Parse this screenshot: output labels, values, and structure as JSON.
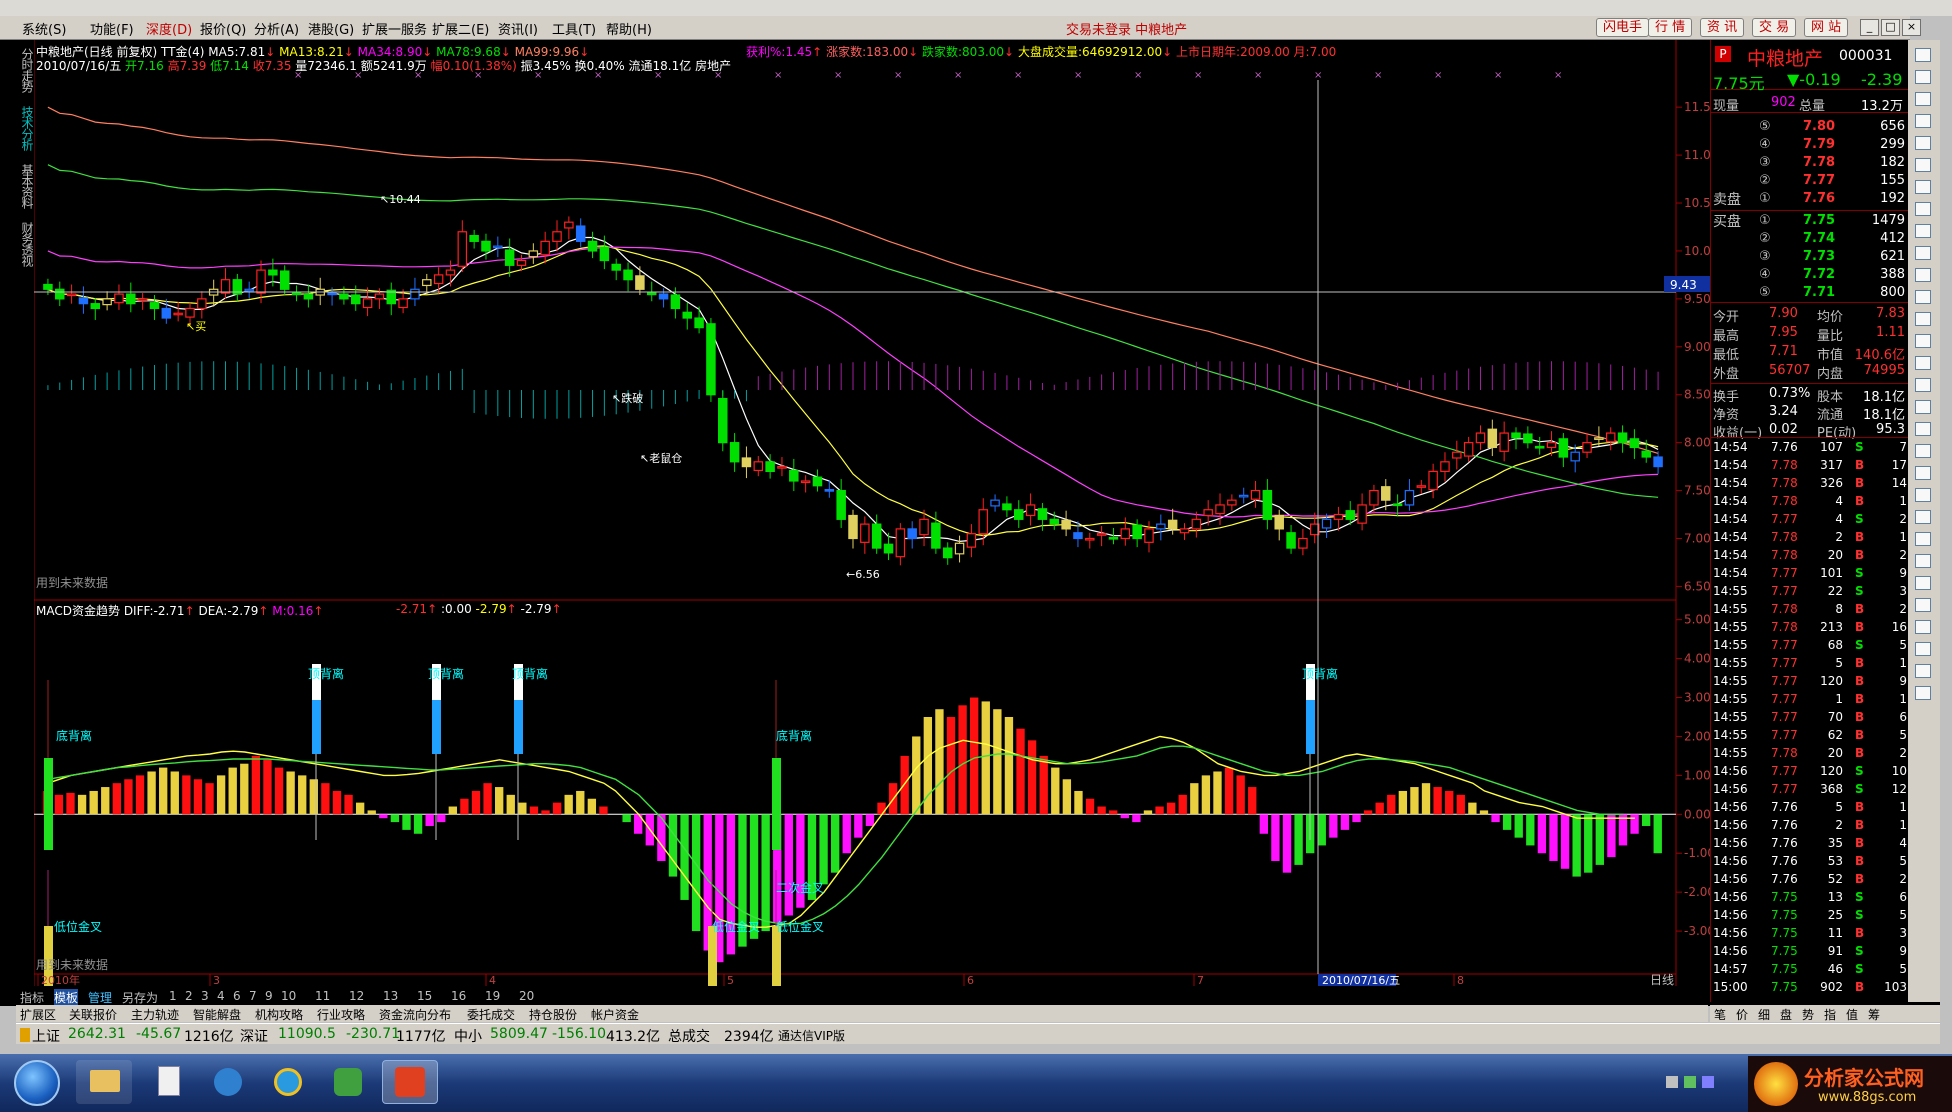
{
  "menu": {
    "items": [
      "系统(S)",
      "功能(F)",
      "深度(D)",
      "报价(Q)",
      "分析(A)",
      "港股(G)",
      "扩展一服务",
      "扩展二(E)",
      "资讯(I)",
      "工具(T)",
      "帮助(H)"
    ],
    "center_msg": "交易未登录  中粮地产",
    "right_buttons": [
      "闪电手",
      "行  情",
      "资  讯",
      "交  易",
      "网  站"
    ]
  },
  "left_tabs": [
    "分时走势",
    "技术分析",
    "基本资料",
    "财务透视"
  ],
  "header": {
    "line1_title": "中粮地产(日线 前复权) TT金(4)",
    "ma5": "MA5:7.81",
    "ma13": "MA13:8.21",
    "ma34": "MA34:8.90",
    "ma78": "MA78:9.68",
    "ma99": "MA99:9.96",
    "win_rate": "获利%:1.45",
    "up_count": "涨家数:183.00",
    "down_count": "跌家数:803.00",
    "market_vol": "大盘成交量:64692912.00",
    "listing": "上市日期年:2009.00 月:7.00",
    "line2_date": "2010/07/16/五",
    "open": "开7.16",
    "high": "高7.39",
    "low": "低7.14",
    "close": "收7.35",
    "vol": "量72346.1",
    "amount": "额5241.9万",
    "change": "幅0.10(1.38%)",
    "amp": "振3.45%",
    "turnover": "换0.40%",
    "float": "流通18.1亿",
    "sector": "房地产"
  },
  "chart_annotations": {
    "buy": "买",
    "peak": "10.44",
    "break": "跌破",
    "trap": "老鼠仓",
    "low": "6.56",
    "future_note": "用到未来数据"
  },
  "macd": {
    "title": "MACD资金趋势",
    "diff": "DIFF:-2.71",
    "dea": "DEA:-2.79",
    "m": "M:0.16",
    "v1": "-2.71",
    "v2": ":0.00",
    "v3": "-2.79",
    "v4": "-2.79",
    "top_div": "顶背离",
    "bottom_div": "底背离",
    "low_cross": "低位金叉",
    "second_cross": "二次金叉",
    "future_note": "用到未来数据"
  },
  "price_axis": [
    "11.50",
    "11.00",
    "10.50",
    "10.00",
    "9.50",
    "9.00",
    "8.50",
    "8.00",
    "7.50",
    "7.00",
    "6.50"
  ],
  "price_cursor": "9.43",
  "macd_axis": [
    "5.00",
    "4.00",
    "3.00",
    "2.00",
    "1.00",
    "0.00",
    "-1.00",
    "-2.00",
    "-3.00"
  ],
  "time_axis": {
    "labels": [
      "2010年",
      "3",
      "4",
      "5",
      "6",
      "7",
      "8"
    ],
    "cursor_date": "2010/07/16/五",
    "period": "日线"
  },
  "bottom_tabs": [
    "指标",
    "模板",
    "管理",
    "另存为",
    "1",
    "2",
    "3",
    "4",
    "6",
    "7",
    "9",
    "10",
    "11",
    "12",
    "13",
    "15",
    "16",
    "19",
    "20"
  ],
  "bottom_tabs2": [
    "扩展区",
    "关联报价",
    "主力轨迹",
    "智能解盘",
    "机构攻略",
    "行业攻略",
    "资金流向分布",
    "委托成交",
    "持仓股份",
    "帐户资金"
  ],
  "status": {
    "sh_label": "上证",
    "sh_value": "2642.31",
    "sh_change": "-45.67",
    "sh_amount": "1216亿",
    "sz_label": "深证",
    "sz_value": "11090.5",
    "sz_change": "-230.71",
    "sz_amount": "1177亿",
    "zx_label": "中小",
    "zx_value": "5809.47",
    "zx_change": "-156.10",
    "zx_amount": "413.2亿",
    "total_label": "总成交",
    "total_value": "2394亿",
    "vendor": "通达信VIP版"
  },
  "quote": {
    "badge": "P",
    "name": "中粮地产",
    "code": "000031",
    "price": "7.75元",
    "change": "▼-0.19",
    "change_pct": "-2.39",
    "cur_vol_label": "现量",
    "cur_vol": "902",
    "total_vol_label": "总量",
    "total_vol": "13.2万",
    "sells": [
      {
        "lvl": "⑤",
        "price": "7.80",
        "vol": "656"
      },
      {
        "lvl": "④",
        "price": "7.79",
        "vol": "299"
      },
      {
        "lvl": "③",
        "price": "7.78",
        "vol": "182"
      },
      {
        "lvl": "②",
        "price": "7.77",
        "vol": "155"
      },
      {
        "lvl": "①",
        "price": "7.76",
        "vol": "192"
      }
    ],
    "sell_label": "卖盘",
    "buy_label": "买盘",
    "buys": [
      {
        "lvl": "①",
        "price": "7.75",
        "vol": "1479"
      },
      {
        "lvl": "②",
        "price": "7.74",
        "vol": "412"
      },
      {
        "lvl": "③",
        "price": "7.73",
        "vol": "621"
      },
      {
        "lvl": "④",
        "price": "7.72",
        "vol": "388"
      },
      {
        "lvl": "⑤",
        "price": "7.71",
        "vol": "800"
      }
    ],
    "stats": [
      {
        "l1": "今开",
        "v1": "7.90",
        "l2": "均价",
        "v2": "7.83"
      },
      {
        "l1": "最高",
        "v1": "7.95",
        "l2": "量比",
        "v2": "1.11"
      },
      {
        "l1": "最低",
        "v1": "7.71",
        "l2": "市值",
        "v2": "140.6亿"
      },
      {
        "l1": "外盘",
        "v1": "56707",
        "l2": "内盘",
        "v2": "74995"
      }
    ],
    "stats2": [
      {
        "l1": "换手",
        "v1": "0.73%",
        "l2": "股本",
        "v2": "18.1亿"
      },
      {
        "l1": "净资",
        "v1": "3.24",
        "l2": "流通",
        "v2": "18.1亿"
      },
      {
        "l1": "收益(一)",
        "v1": "0.02",
        "l2": "PE(动)",
        "v2": "95.3"
      }
    ],
    "ticks": [
      {
        "t": "14:54",
        "p": "7.76",
        "v": "107",
        "s": "S",
        "n": "7"
      },
      {
        "t": "14:54",
        "p": "7.78",
        "v": "317",
        "s": "B",
        "n": "17"
      },
      {
        "t": "14:54",
        "p": "7.78",
        "v": "326",
        "s": "B",
        "n": "14"
      },
      {
        "t": "14:54",
        "p": "7.78",
        "v": "4",
        "s": "B",
        "n": "1"
      },
      {
        "t": "14:54",
        "p": "7.77",
        "v": "4",
        "s": "S",
        "n": "2"
      },
      {
        "t": "14:54",
        "p": "7.78",
        "v": "2",
        "s": "B",
        "n": "1"
      },
      {
        "t": "14:54",
        "p": "7.78",
        "v": "20",
        "s": "B",
        "n": "2"
      },
      {
        "t": "14:54",
        "p": "7.77",
        "v": "101",
        "s": "S",
        "n": "9"
      },
      {
        "t": "14:55",
        "p": "7.77",
        "v": "22",
        "s": "S",
        "n": "3"
      },
      {
        "t": "14:55",
        "p": "7.78",
        "v": "8",
        "s": "B",
        "n": "2"
      },
      {
        "t": "14:55",
        "p": "7.78",
        "v": "213",
        "s": "B",
        "n": "16"
      },
      {
        "t": "14:55",
        "p": "7.77",
        "v": "68",
        "s": "S",
        "n": "5"
      },
      {
        "t": "14:55",
        "p": "7.77",
        "v": "5",
        "s": "B",
        "n": "1"
      },
      {
        "t": "14:55",
        "p": "7.77",
        "v": "120",
        "s": "B",
        "n": "9"
      },
      {
        "t": "14:55",
        "p": "7.77",
        "v": "1",
        "s": "B",
        "n": "1"
      },
      {
        "t": "14:55",
        "p": "7.77",
        "v": "70",
        "s": "B",
        "n": "6"
      },
      {
        "t": "14:55",
        "p": "7.77",
        "v": "62",
        "s": "B",
        "n": "5"
      },
      {
        "t": "14:55",
        "p": "7.78",
        "v": "20",
        "s": "B",
        "n": "2"
      },
      {
        "t": "14:56",
        "p": "7.77",
        "v": "120",
        "s": "S",
        "n": "10"
      },
      {
        "t": "14:56",
        "p": "7.77",
        "v": "368",
        "s": "S",
        "n": "12"
      },
      {
        "t": "14:56",
        "p": "7.76",
        "v": "5",
        "s": "B",
        "n": "1"
      },
      {
        "t": "14:56",
        "p": "7.76",
        "v": "2",
        "s": "B",
        "n": "1"
      },
      {
        "t": "14:56",
        "p": "7.76",
        "v": "35",
        "s": "B",
        "n": "4"
      },
      {
        "t": "14:56",
        "p": "7.76",
        "v": "53",
        "s": "B",
        "n": "5"
      },
      {
        "t": "14:56",
        "p": "7.76",
        "v": "52",
        "s": "B",
        "n": "2"
      },
      {
        "t": "14:56",
        "p": "7.75",
        "v": "13",
        "s": "S",
        "n": "6"
      },
      {
        "t": "14:56",
        "p": "7.75",
        "v": "25",
        "s": "S",
        "n": "5"
      },
      {
        "t": "14:56",
        "p": "7.75",
        "v": "11",
        "s": "B",
        "n": "3"
      },
      {
        "t": "14:56",
        "p": "7.75",
        "v": "91",
        "s": "S",
        "n": "9"
      },
      {
        "t": "14:57",
        "p": "7.75",
        "v": "46",
        "s": "S",
        "n": "5"
      },
      {
        "t": "15:00",
        "p": "7.75",
        "v": "902",
        "s": "B",
        "n": "103"
      }
    ]
  },
  "qp_tabs": [
    "笔",
    "价",
    "细",
    "盘",
    "势",
    "指",
    "值",
    "筹"
  ],
  "logo": {
    "name": "分析家公式网",
    "url": "www.88gs.com"
  },
  "chart_data": [
    {
      "type": "candlestick",
      "title": "中粮地产(日线 前复权) TT金(4)",
      "ylim": [
        6.4,
        11.7
      ],
      "x_labels": [
        "2010年",
        "3",
        "4",
        "5",
        "6",
        "7",
        "8"
      ],
      "annotations": {
        "peak": 10.44,
        "low": 6.56
      },
      "series": [
        {
          "name": "MA5",
          "value": 7.81
        },
        {
          "name": "MA13",
          "value": 8.21
        },
        {
          "name": "MA34",
          "value": 8.9
        },
        {
          "name": "MA78",
          "value": 9.68
        },
        {
          "name": "MA99",
          "value": 9.96
        }
      ],
      "closes": [
        9.6,
        9.5,
        9.55,
        9.45,
        9.4,
        9.5,
        9.55,
        9.45,
        9.5,
        9.4,
        9.3,
        9.35,
        9.4,
        9.5,
        9.6,
        9.7,
        9.55,
        9.6,
        9.8,
        9.75,
        9.6,
        9.55,
        9.5,
        9.6,
        9.55,
        9.5,
        9.45,
        9.5,
        9.55,
        9.45,
        9.5,
        9.6,
        9.7,
        9.75,
        9.8,
        10.2,
        10.1,
        10.0,
        10.05,
        9.85,
        9.9,
        10.0,
        10.1,
        10.2,
        10.3,
        10.1,
        10.0,
        9.9,
        9.8,
        9.7,
        9.6,
        9.55,
        9.5,
        9.4,
        9.3,
        9.2,
        8.5,
        8.0,
        7.8,
        7.75,
        7.8,
        7.7,
        7.75,
        7.6,
        7.6,
        7.55,
        7.5,
        7.2,
        7.0,
        7.15,
        6.9,
        6.85,
        7.1,
        7.0,
        7.2,
        6.9,
        6.8,
        6.95,
        7.05,
        7.3,
        7.4,
        7.3,
        7.2,
        7.35,
        7.2,
        7.15,
        7.1,
        7.0,
        7.0,
        7.05,
        7.0,
        7.1,
        7.0,
        7.1,
        7.15,
        7.1,
        7.1,
        7.2,
        7.3,
        7.35,
        7.4,
        7.45,
        7.5,
        7.2,
        7.1,
        6.9,
        7.0,
        7.15,
        7.2,
        7.25,
        7.2,
        7.35,
        7.5,
        7.4,
        7.35,
        7.5,
        7.55,
        7.7,
        7.8,
        7.9,
        8.0,
        8.1,
        7.95,
        8.1,
        8.05,
        8.0,
        7.95,
        8.0,
        7.85,
        7.9,
        8.0,
        8.05,
        8.1,
        8.0,
        7.95,
        7.85,
        7.75
      ]
    },
    {
      "type": "bar",
      "title": "MACD资金趋势",
      "ylim": [
        -4.0,
        5.3
      ],
      "series": [
        {
          "name": "DIFF",
          "value": -2.71
        },
        {
          "name": "DEA",
          "value": -2.79
        },
        {
          "name": "M",
          "value": 0.16
        }
      ],
      "hist": [
        0.6,
        0.5,
        0.55,
        0.5,
        0.6,
        0.7,
        0.8,
        0.9,
        1.0,
        1.1,
        1.2,
        1.1,
        1.0,
        0.9,
        0.8,
        1.0,
        1.2,
        1.3,
        1.5,
        1.4,
        1.2,
        1.1,
        1.0,
        0.9,
        0.8,
        0.6,
        0.5,
        0.3,
        0.1,
        -0.1,
        -0.2,
        -0.4,
        -0.5,
        -0.3,
        -0.2,
        0.2,
        0.4,
        0.6,
        0.8,
        0.7,
        0.5,
        0.3,
        0.2,
        0.1,
        0.3,
        0.5,
        0.6,
        0.4,
        0.2,
        0.0,
        -0.2,
        -0.5,
        -0.8,
        -1.2,
        -1.6,
        -2.2,
        -3.0,
        -3.5,
        -3.8,
        -3.6,
        -3.4,
        -3.2,
        -3.0,
        -2.8,
        -2.6,
        -2.4,
        -2.2,
        -1.8,
        -1.5,
        -1.0,
        -0.6,
        -0.3,
        0.3,
        0.8,
        1.5,
        2.0,
        2.5,
        2.7,
        2.5,
        2.8,
        3.0,
        2.9,
        2.7,
        2.5,
        2.2,
        1.9,
        1.5,
        1.2,
        0.9,
        0.6,
        0.4,
        0.2,
        0.1,
        -0.1,
        -0.2,
        0.1,
        0.2,
        0.3,
        0.5,
        0.8,
        1.0,
        1.1,
        1.2,
        1.0,
        0.7,
        -0.5,
        -1.2,
        -1.5,
        -1.3,
        -1.0,
        -0.8,
        -0.6,
        -0.4,
        -0.2,
        0.1,
        0.3,
        0.5,
        0.6,
        0.7,
        0.8,
        0.7,
        0.6,
        0.5,
        0.3,
        0.1,
        -0.2,
        -0.4,
        -0.6,
        -0.8,
        -1.0,
        -1.2,
        -1.4,
        -1.6,
        -1.5,
        -1.3,
        -1.1,
        -0.8,
        -0.5,
        -0.3,
        -1.0
      ],
      "diff": [
        0.8,
        0.9,
        1.0,
        1.05,
        1.1,
        1.15,
        1.2,
        1.25,
        1.3,
        1.35,
        1.4,
        1.45,
        1.5,
        1.52,
        1.55,
        1.6,
        1.62,
        1.6,
        1.55,
        1.5,
        1.45,
        1.4,
        1.35,
        1.3,
        1.25,
        1.2,
        1.15,
        1.1,
        1.05,
        1.0,
        1.0,
        1.02,
        1.05,
        1.1,
        1.15,
        1.2,
        1.25,
        1.3,
        1.35,
        1.4,
        1.35,
        1.3,
        1.25,
        1.2,
        1.15,
        1.1,
        1.0,
        0.9,
        0.8,
        0.6,
        0.3,
        0.0,
        -0.4,
        -0.8,
        -1.2,
        -1.6,
        -2.0,
        -2.4,
        -2.7,
        -2.8,
        -2.85,
        -2.9,
        -2.9,
        -2.85,
        -2.8,
        -2.6,
        -2.3,
        -2.0,
        -1.6,
        -1.2,
        -0.8,
        -0.4,
        0.0,
        0.4,
        0.8,
        1.2,
        1.5,
        1.7,
        1.8,
        1.9,
        1.85,
        1.8,
        1.7,
        1.6,
        1.5,
        1.4,
        1.35,
        1.3,
        1.3,
        1.35,
        1.4,
        1.5,
        1.6,
        1.7,
        1.8,
        1.9,
        2.0,
        1.95,
        1.85,
        1.7,
        1.5,
        1.3,
        1.2,
        1.1,
        1.05,
        1.0,
        1.0,
        1.05,
        1.1,
        1.2,
        1.3,
        1.4,
        1.5,
        1.55,
        1.5,
        1.45,
        1.4,
        1.35,
        1.3,
        1.2,
        1.1,
        1.0,
        0.9,
        0.8,
        0.6,
        0.5,
        0.4,
        0.3,
        0.25,
        0.2,
        0.1,
        0.0,
        -0.1,
        -0.1,
        -0.1,
        -0.1,
        -0.1,
        -0.1
      ],
      "dea": [
        0.9,
        0.95,
        1.0,
        1.05,
        1.1,
        1.15,
        1.2,
        1.22,
        1.25,
        1.28,
        1.3,
        1.32,
        1.35,
        1.37,
        1.38,
        1.4,
        1.42,
        1.42,
        1.42,
        1.42,
        1.4,
        1.38,
        1.36,
        1.34,
        1.32,
        1.3,
        1.28,
        1.26,
        1.24,
        1.22,
        1.2,
        1.18,
        1.16,
        1.14,
        1.14,
        1.16,
        1.18,
        1.2,
        1.22,
        1.24,
        1.26,
        1.28,
        1.3,
        1.3,
        1.28,
        1.25,
        1.2,
        1.1,
        1.0,
        0.9,
        0.7,
        0.5,
        0.2,
        -0.1,
        -0.5,
        -0.9,
        -1.3,
        -1.7,
        -2.0,
        -2.3,
        -2.5,
        -2.65,
        -2.75,
        -2.8,
        -2.82,
        -2.8,
        -2.7,
        -2.55,
        -2.35,
        -2.1,
        -1.8,
        -1.45,
        -1.1,
        -0.7,
        -0.3,
        0.1,
        0.5,
        0.8,
        1.1,
        1.3,
        1.45,
        1.5,
        1.55,
        1.55,
        1.5,
        1.45,
        1.4,
        1.35,
        1.3,
        1.3,
        1.32,
        1.35,
        1.4,
        1.45,
        1.5,
        1.6,
        1.7,
        1.75,
        1.75,
        1.7,
        1.6,
        1.5,
        1.4,
        1.3,
        1.2,
        1.1,
        1.05,
        1.0,
        1.0,
        1.05,
        1.1,
        1.2,
        1.3,
        1.38,
        1.42,
        1.42,
        1.4,
        1.38,
        1.35,
        1.3,
        1.25,
        1.2,
        1.1,
        1.0,
        0.9,
        0.8,
        0.7,
        0.6,
        0.5,
        0.4,
        0.3,
        0.2,
        0.1,
        0.05,
        0.0,
        0.0,
        0.0
      ]
    }
  ]
}
